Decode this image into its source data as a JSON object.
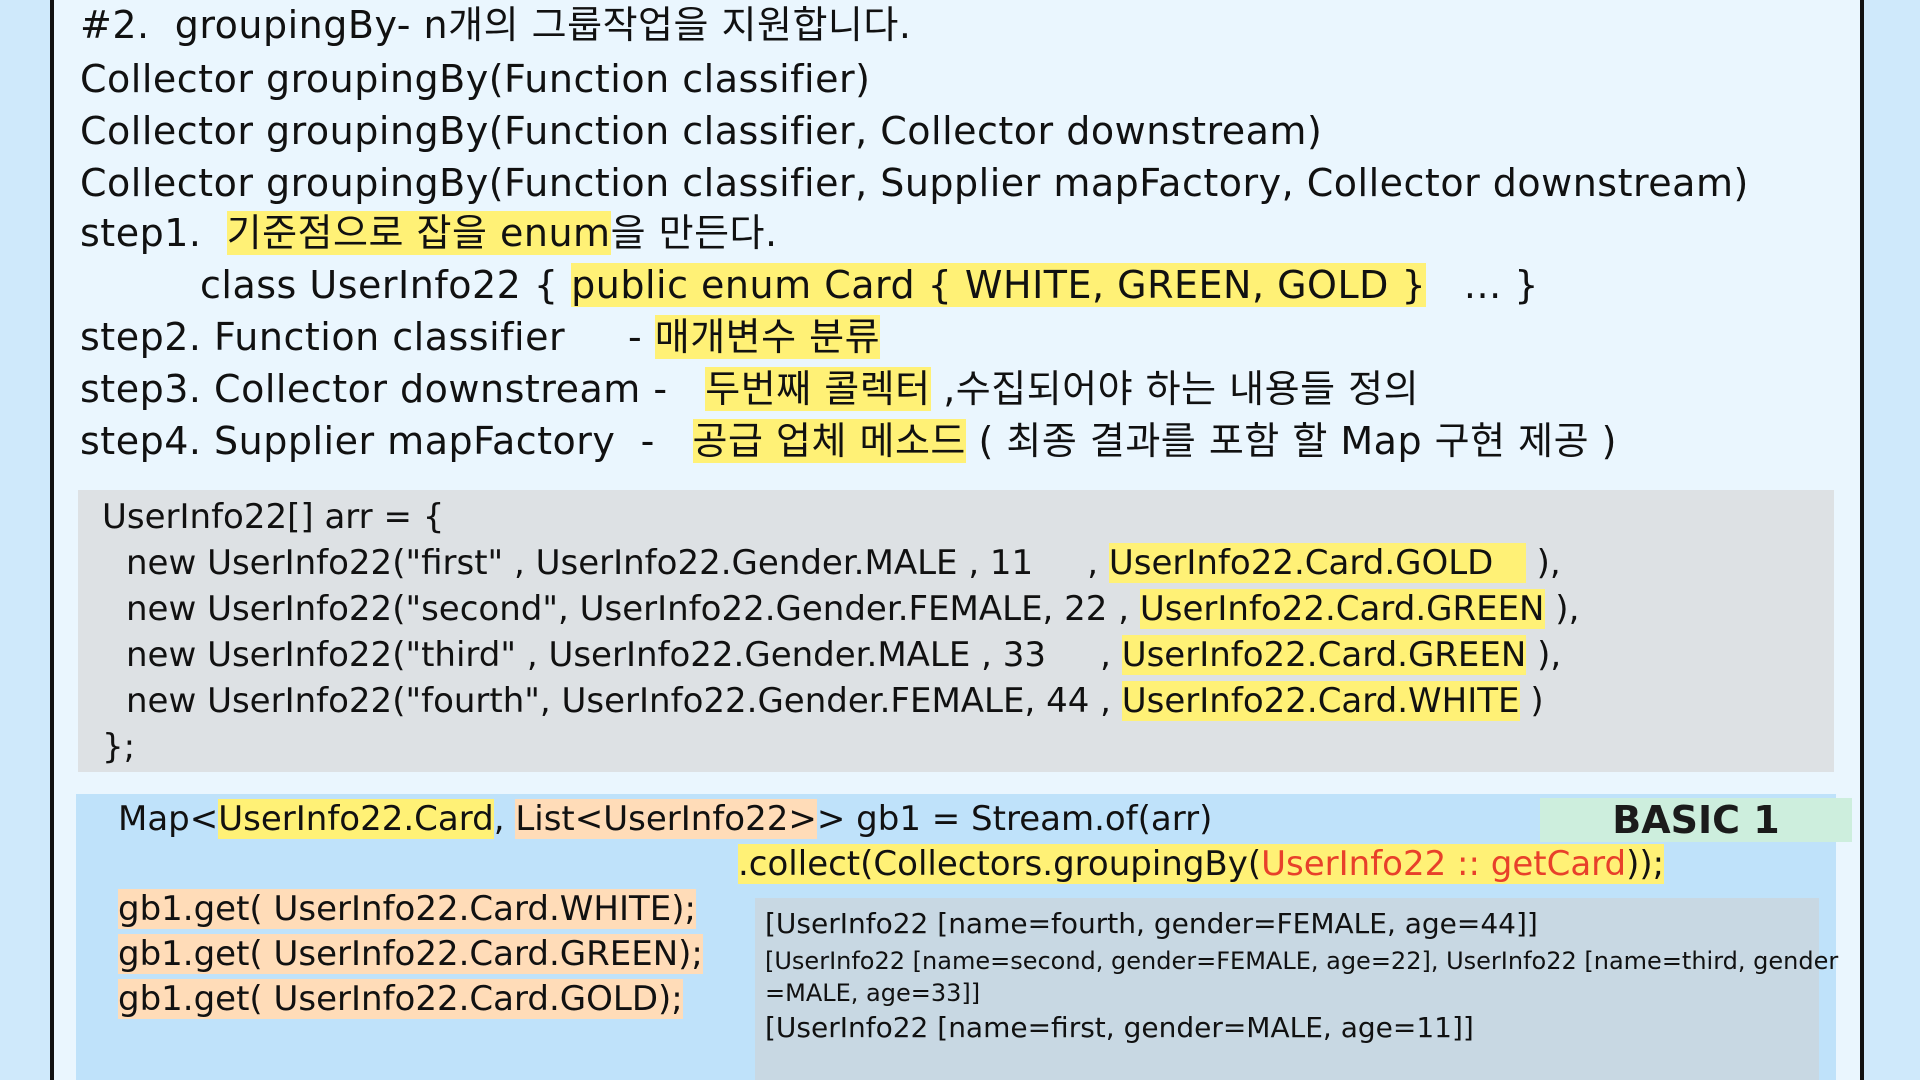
{
  "heading": "#2.  groupingBy- n개의 그룹작업을 지원합니다.",
  "signatures": [
    "Collector groupingBy(Function classifier)",
    "Collector groupingBy(Function classifier, Collector downstream)",
    "Collector groupingBy(Function classifier, Supplier mapFactory, Collector downstream)"
  ],
  "step1": {
    "prefix": "step1.  ",
    "highlight": "기준점으로 잡을 enum",
    "suffix": "을 만든다."
  },
  "class_line": {
    "prefix": "class UserInfo22 { ",
    "highlight": "public enum Card { WHITE, GREEN, GOLD }",
    "suffix": "   ... }"
  },
  "step2": {
    "prefix": "step2. Function classifier     - ",
    "highlight": "매개변수 분류",
    "suffix": ""
  },
  "step3": {
    "prefix": "step3. Collector downstream -   ",
    "highlight": "두번째 콜렉터",
    "suffix": " ,수집되어야 하는 내용들 정의"
  },
  "step4": {
    "prefix": "step4. Supplier mapFactory  -   ",
    "highlight": "공급 업체 메소드",
    "suffix": " ( 최종 결과를 포함 할 Map 구현 제공 )"
  },
  "array_code": {
    "open": "UserInfo22[] arr = {",
    "rows": [
      {
        "text": "new UserInfo22(\"first\" , UserInfo22.Gender.MALE , 11     , ",
        "card": "UserInfo22.Card.GOLD   ",
        "end": " ),"
      },
      {
        "text": "new UserInfo22(\"second\", UserInfo22.Gender.FEMALE, 22 , ",
        "card": "UserInfo22.Card.GREEN",
        "end": " ),"
      },
      {
        "text": "new UserInfo22(\"third\" , UserInfo22.Gender.MALE , 33     , ",
        "card": "UserInfo22.Card.GREEN",
        "end": " ),"
      },
      {
        "text": "new UserInfo22(\"fourth\", UserInfo22.Gender.FEMALE, 44 , ",
        "card": "UserInfo22.Card.WHITE",
        "end": " )"
      }
    ],
    "close": "};"
  },
  "basic": {
    "tag": "BASIC 1",
    "map_prefix": "Map<",
    "map_key": "UserInfo22.Card",
    "map_sep": ", ",
    "map_val": "List<UserInfo22>",
    "map_suffix": "> gb1 = Stream.of(arr)",
    "collect_prefix": ".collect(Collectors.groupingBy(",
    "collect_ref": "UserInfo22 :: getCard",
    "collect_suffix": "));",
    "gets": [
      "gb1.get( UserInfo22.Card.WHITE);",
      "gb1.get( UserInfo22.Card.GREEN);",
      "gb1.get( UserInfo22.Card.GOLD);"
    ],
    "output": [
      "[UserInfo22 [name=fourth, gender=FEMALE, age=44]]",
      "[UserInfo22 [name=second, gender=FEMALE, age=22], UserInfo22 [name=third, gender",
      "=MALE, age=33]]",
      "[UserInfo22 [name=first, gender=MALE, age=11]]"
    ]
  },
  "colors": {
    "highlight_yellow": "#fff176",
    "highlight_orange": "#ffdcb8",
    "method_ref_red": "#e8402a",
    "panel_blue": "#bfe2fa",
    "code_gray": "#dde1e4"
  }
}
